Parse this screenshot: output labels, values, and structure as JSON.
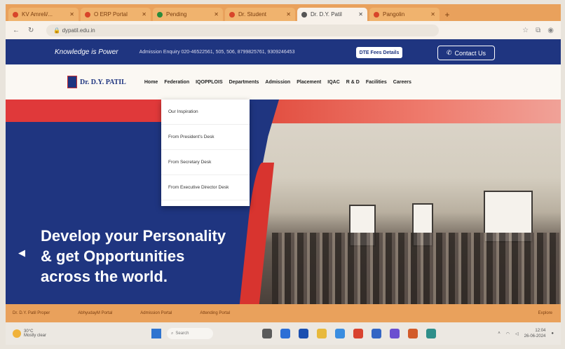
{
  "browser": {
    "tabs": [
      {
        "label": "KV Amreli/...",
        "active": false
      },
      {
        "label": "O ERP Portal",
        "active": false
      },
      {
        "label": "Pending",
        "active": false
      },
      {
        "label": "Dr. Student",
        "active": false
      },
      {
        "label": "Dr. D.Y. Patil",
        "active": true
      },
      {
        "label": "Pangolin",
        "active": false
      }
    ],
    "url": "dypatil.edu.in"
  },
  "site": {
    "motto": "Knowledge is Power",
    "enquiry": "Admission Enquiry 020-46522561, 505, 506, 8799825761, 9309246453",
    "fee_button": "DTE Fees Details",
    "contact_button": "Contact Us",
    "logo_title": "Dr. D.Y. PATIL",
    "nav": [
      "Home",
      "Federation",
      "IQOPPLOIS",
      "Departments",
      "Admission",
      "Placement",
      "IQAC",
      "R & D",
      "Facilities",
      "Careers"
    ]
  },
  "dropdown": {
    "items": [
      "Our Inspiration",
      "From President's Desk",
      "From Secretary Desk",
      "From Executive Director Desk"
    ]
  },
  "hero": {
    "line1": "Develop your Personality",
    "line2": "& get Opportunities",
    "line3": "across the world."
  },
  "bottombar": {
    "items": [
      "Dr. D.Y. Patil Proper",
      "AbhyudayM Portal",
      "Admission Portal",
      "Attending Portal",
      "Explore"
    ]
  },
  "taskbar": {
    "weather_temp": "30°C",
    "weather_desc": "Mostly clear",
    "search": "Search",
    "time": "12:04",
    "date": "26-06-2024"
  }
}
